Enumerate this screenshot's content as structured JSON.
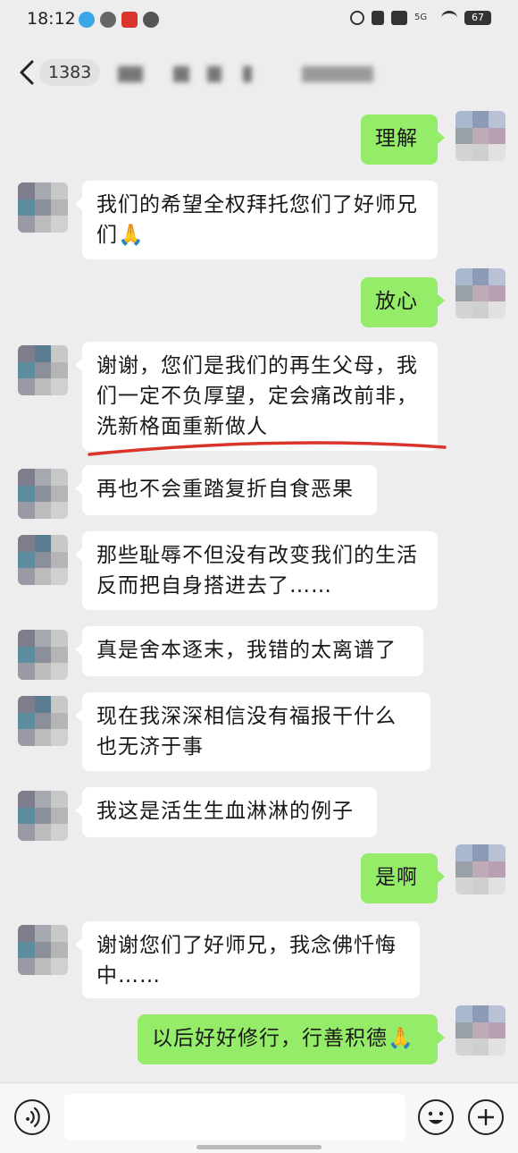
{
  "status_bar": {
    "time": "18:12",
    "battery": "67",
    "network": "5G"
  },
  "header": {
    "back_count": "1383",
    "title": ""
  },
  "messages": [
    {
      "side": "right",
      "text": "理解"
    },
    {
      "side": "left",
      "text": "我们的希望全权拜托您们了好师兄们🙏"
    },
    {
      "side": "right",
      "text": "放心"
    },
    {
      "side": "left",
      "text": "谢谢，您们是我们的再生父母，我们一定不负厚望，定会痛改前非，洗新格面重新做人"
    },
    {
      "side": "left",
      "text": "再也不会重踏复折自食恶果"
    },
    {
      "side": "left",
      "text": "那些耻辱不但没有改变我们的生活反而把自身搭进去了……"
    },
    {
      "side": "left",
      "text": "真是舍本逐末，我错的太离谱了"
    },
    {
      "side": "left",
      "text": "现在我深深相信没有福报干什么也无济于事"
    },
    {
      "side": "left",
      "text": "我这是活生生血淋淋的例子"
    },
    {
      "side": "right",
      "text": "是啊"
    },
    {
      "side": "left",
      "text": "谢谢您们了好师兄，我念佛忏悔中……"
    },
    {
      "side": "right",
      "text": "以后好好修行，行善积德🙏"
    }
  ],
  "input_bar": {
    "placeholder": "",
    "icons": [
      "voice-icon",
      "emoji-icon",
      "plus-icon"
    ]
  },
  "colors": {
    "background": "#ededed",
    "incoming_bubble": "#ffffff",
    "outgoing_bubble": "#95ec69",
    "underline": "#d9342b"
  }
}
